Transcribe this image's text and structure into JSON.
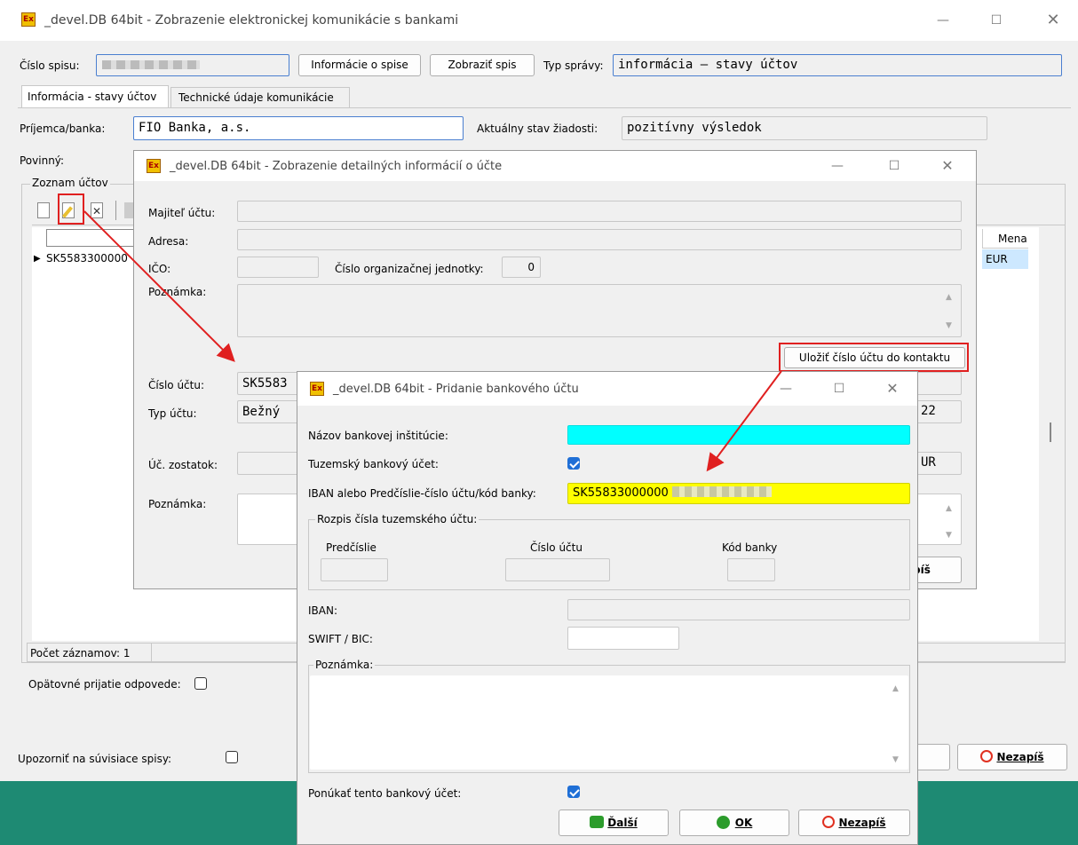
{
  "main": {
    "title": "_devel.DB 64bit - Zobrazenie elektronickej komunikácie s bankami",
    "cislo_spisu_label": "Číslo spisu:",
    "btn_info": "Informácie o spise",
    "btn_show": "Zobraziť spis",
    "typ_spravy_label": "Typ správy:",
    "typ_spravy_value": "informácia – stavy účtov",
    "tabs": [
      "Informácia - stavy účtov",
      "Technické údaje komunikácie"
    ],
    "prijemca_label": "Príjemca/banka:",
    "prijemca_value": "FIO Banka, a.s.",
    "stav_label": "Aktuálny stav žiadosti:",
    "stav_value": "pozitívny výsledok",
    "povinny_label": "Povinný:",
    "zoznam_label": "Zoznam účtov",
    "row_account": "SK5583300000",
    "col_mena": "Mena",
    "row_mena": "EUR",
    "pocet": "Počet záznamov: 1",
    "opatovne_label": "Opätovné prijatie odpovede:",
    "upozornit_label": "Upozorniť na súvisiace spisy:",
    "nezapis": "Nezapíš"
  },
  "detail": {
    "title": "_devel.DB 64bit - Zobrazenie detailných informácií o účte",
    "majitel_label": "Majiteľ účtu:",
    "adresa_label": "Adresa:",
    "ico_label": "IČO:",
    "org_label": "Číslo organizačnej jednotky:",
    "org_value": "0",
    "poznamka_label": "Poznámka:",
    "ulozit_btn": "Uložiť číslo účtu do kontaktu",
    "cislo_uctu_label": "Číslo účtu:",
    "cislo_uctu_value": "SK5583",
    "typ_uctu_label": "Typ účtu:",
    "typ_uctu_value": "Bežný",
    "typ_uctu_right": "22",
    "zostatok_label": "Úč. zostatok:",
    "zostatok_right": "UR",
    "poznamka2_label": "Poznámka:",
    "zapis_partial": "píš"
  },
  "add": {
    "title": "_devel.DB 64bit - Pridanie bankového účtu",
    "nazov_label": "Názov bankovej inštitúcie:",
    "tuzemsky_label": "Tuzemský bankový účet:",
    "iban_label": "IBAN alebo Predčíslie-číslo účtu/kód banky:",
    "iban_value": "SK55833000000",
    "rozpis_label": "Rozpis čísla tuzemského účtu:",
    "predcislie": "Predčíslie",
    "cislo_uctu": "Číslo účtu",
    "kod_banky": "Kód banky",
    "iban2_label": "IBAN:",
    "swift_label": "SWIFT / BIC:",
    "poznamka_label": "Poznámka:",
    "ponukat_label": "Ponúkať tento bankový účet:",
    "btn_dalsi": "Ďalší",
    "btn_ok": "OK",
    "btn_nezapis": "Nezapíš"
  },
  "icons": [
    "app-logo-icon",
    "minimize-icon",
    "maximize-icon",
    "close-icon",
    "new-record-icon",
    "edit-record-icon",
    "delete-record-icon",
    "scroll-up-icon",
    "scroll-down-icon",
    "next-icon",
    "ok-icon",
    "cancel-icon"
  ],
  "colors": {
    "background": "#1e8a73",
    "highlight_cyan": "#00ffff",
    "highlight_yellow": "#ffff00",
    "annotation_red": "#e02020",
    "selection": "#cde8ff"
  }
}
